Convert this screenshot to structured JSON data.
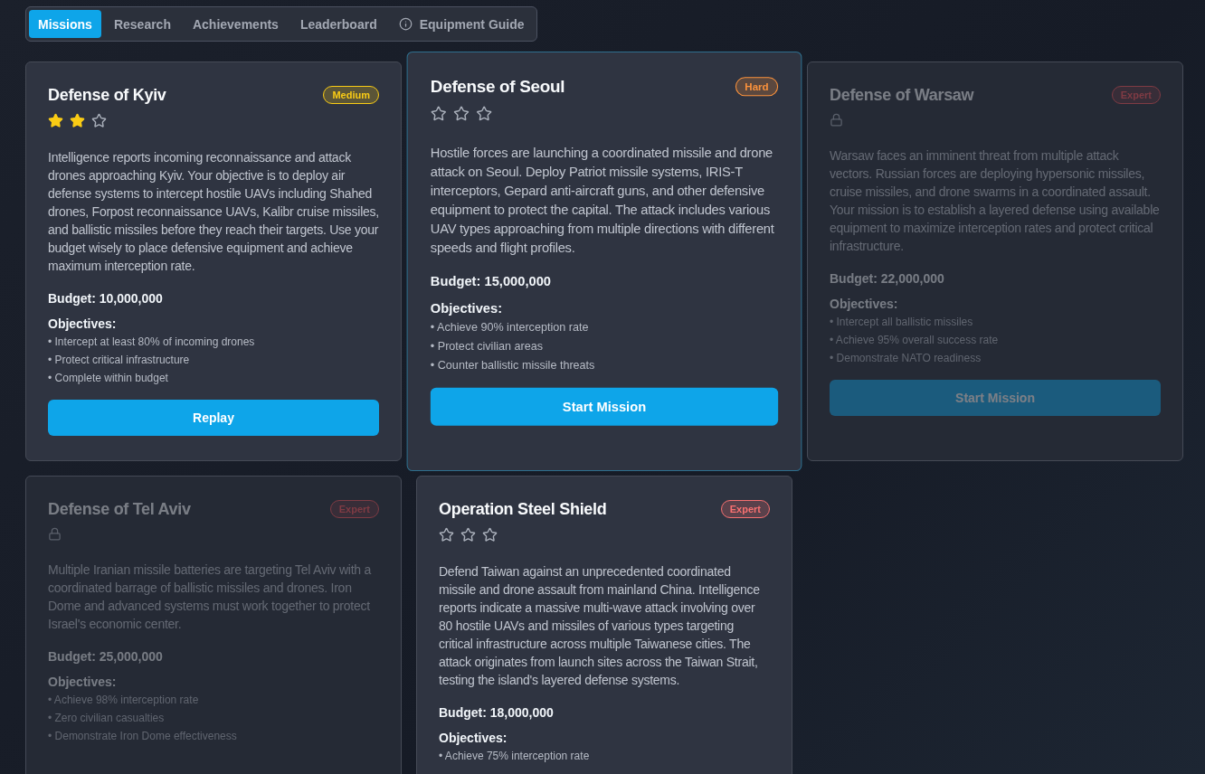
{
  "tabs": [
    {
      "label": "Missions",
      "selected": true
    },
    {
      "label": "Research",
      "selected": false
    },
    {
      "label": "Achievements",
      "selected": false
    },
    {
      "label": "Leaderboard",
      "selected": false
    },
    {
      "label": "Equipment Guide",
      "selected": false,
      "kind": "info"
    }
  ],
  "missions": [
    {
      "title": "Defense of Kyiv",
      "badge": {
        "label": "Medium",
        "color": "#facc15"
      },
      "locked": false,
      "highlighted": false,
      "stars": 2,
      "description": "Intelligence reports incoming reconnaissance and attack drones approaching Kyiv. Your objective is to deploy air defense systems to intercept hostile UAVs including Shahed drones, Forpost reconnaissance UAVs, Kalibr cruise missiles, and ballistic missiles before they reach their targets. Use your budget wisely to place defensive equipment and achieve maximum interception rate.",
      "budget": "Budget: 10,000,000",
      "objectives_label": "Objectives:",
      "objectives": [
        "• Intercept at least 80% of incoming drones",
        "• Protect critical infrastructure",
        "• Complete within budget"
      ],
      "button": "Replay"
    },
    {
      "title": "Defense of Seoul",
      "badge": {
        "label": "Hard",
        "color": "#fb923c"
      },
      "locked": false,
      "highlighted": true,
      "stars": 0,
      "description": "Hostile forces are launching a coordinated missile and drone attack on Seoul. Deploy Patriot missile systems, IRIS-T interceptors, Gepard anti-aircraft guns, and other defensive equipment to protect the capital. The attack includes various UAV types approaching from multiple directions with different speeds and flight profiles.",
      "budget": "Budget: 15,000,000",
      "objectives_label": "Objectives:",
      "objectives": [
        "• Achieve 90% interception rate",
        "• Protect civilian areas",
        "• Counter ballistic missile threats"
      ],
      "button": "Start Mission"
    },
    {
      "title": "Defense of Warsaw",
      "badge": {
        "label": "Expert",
        "color": "#7f3b44"
      },
      "locked": true,
      "highlighted": false,
      "description": "Warsaw faces an imminent threat from multiple attack vectors. Russian forces are deploying hypersonic missiles, cruise missiles, and drone swarms in a coordinated assault. Your mission is to establish a layered defense using available equipment to maximize interception rates and protect critical infrastructure.",
      "budget": "Budget: 22,000,000",
      "objectives_label": "Objectives:",
      "objectives": [
        "• Intercept all ballistic missiles",
        "• Achieve 95% overall success rate",
        "• Demonstrate NATO readiness"
      ],
      "button": "Start Mission"
    },
    {
      "title": "Defense of Tel Aviv",
      "badge": {
        "label": "Expert",
        "color": "#7f3b44"
      },
      "locked": true,
      "highlighted": false,
      "description": "Multiple Iranian missile batteries are targeting Tel Aviv with a coordinated barrage of ballistic missiles and drones. Iron Dome and advanced systems must work together to protect Israel's economic center.",
      "budget": "Budget: 25,000,000",
      "objectives_label": "Objectives:",
      "objectives": [
        "• Achieve 98% interception rate",
        "• Zero civilian casualties",
        "• Demonstrate Iron Dome effectiveness"
      ]
    },
    {
      "title": "Operation Steel Shield",
      "badge": {
        "label": "Expert",
        "color": "#f87171"
      },
      "locked": false,
      "highlighted": false,
      "stars": 0,
      "description": "Defend Taiwan against an unprecedented coordinated missile and drone assault from mainland China. Intelligence reports indicate a massive multi-wave attack involving over 80 hostile UAVs and missiles of various types targeting critical infrastructure across multiple Taiwanese cities. The attack originates from launch sites across the Taiwan Strait, testing the island's layered defense systems.",
      "budget": "Budget: 18,000,000",
      "objectives_label": "Objectives:",
      "objectives": [
        "• Achieve 75% interception rate"
      ]
    }
  ]
}
